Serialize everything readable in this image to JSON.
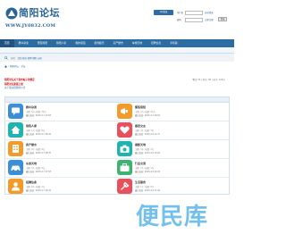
{
  "header": {
    "site_title": "简阳论坛",
    "site_url": "WWW.JY0832.COM",
    "qq_login_label": "QQ登录"
  },
  "login": {
    "username_label": "用户名",
    "password_label": "密码",
    "autologin_label": "自动登录",
    "register_label": "立即注册",
    "submit_label": "登录"
  },
  "nav": {
    "items": [
      {
        "label": "首页"
      },
      {
        "label": "群众杂谈"
      },
      {
        "label": "聚焦简阳"
      },
      {
        "label": "简阳人家"
      },
      {
        "label": "我的家园"
      },
      {
        "label": "游戏娱乐"
      },
      {
        "label": "房产楼市"
      },
      {
        "label": "车旅天地"
      },
      {
        "label": "招聘信息"
      },
      {
        "label": "手机版"
      }
    ]
  },
  "search": {
    "hot_label": "热搜:",
    "hot_words": "活动 拆迁 招聘 简阳 公园"
  },
  "breadcrumb": {
    "items": [
      "简阳论坛",
      "论坛"
    ]
  },
  "notices": {
    "items": [
      "简阳论坛关于发布帖子的规定",
      "简阳论坛新版上线",
      "关于版主招募的公告"
    ],
    "side_label": "今日:",
    "side_value": "54 | 昨日: 80 | 帖子: 126万"
  },
  "forums": [
    {
      "title": "群众杂谈",
      "meta": "主题: 3万, 帖数: 32万",
      "last": "最后发表: 2025-4-7 10:05"
    },
    {
      "title": "聚焦简阳",
      "meta": "主题: 2万, 帖数: 21万",
      "last": "最后发表: 2025-4-7 09:51"
    },
    {
      "title": "简阳人家",
      "meta": "主题: 1万, 帖数: 9万",
      "last": "最后发表: 2025-4-7 09:40"
    },
    {
      "title": "婚恋交友",
      "meta": "主题: 4千, 帖数: 3万",
      "last": "最后发表: 2025-4-6 22:17"
    },
    {
      "title": "房产楼市",
      "meta": "主题: 9千, 帖数: 6万",
      "last": "最后发表: 2025-4-7 08:33"
    },
    {
      "title": "摄影天地",
      "meta": "主题: 3千, 帖数: 2万",
      "last": "最后发表: 2025-4-6 18:02"
    },
    {
      "title": "车旅天地",
      "meta": "主题: 5千, 帖数: 4万",
      "last": "最后发表: 2025-4-7 07:55"
    },
    {
      "title": "行业交流",
      "meta": "主题: 2千, 帖数: 1万",
      "last": "最后发表: 2025-4-5 16:20"
    },
    {
      "title": "招聘信息",
      "meta": "主题: 6千, 帖数: 2万",
      "last": "最后发表: 2025-4-7 09:12"
    },
    {
      "title": "生活服务",
      "meta": "主题: 1千, 帖数: 8千",
      "last": "最后发表: 2025-4-6 21:44"
    }
  ],
  "watermark": {
    "text": "便民库"
  },
  "colors": {
    "brand_blue": "#2b6ca3",
    "notice_red": "#cc0000",
    "icon_red": "#e8505b",
    "icon_teal": "#1eb5b0",
    "icon_blue": "#3a8fd6",
    "icon_orange": "#f29b2b",
    "icon_green": "#3cb371"
  }
}
